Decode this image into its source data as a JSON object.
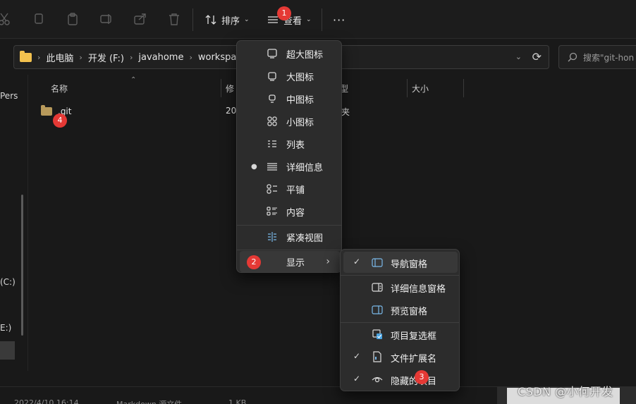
{
  "toolbar": {
    "sort_label": "排序",
    "view_label": "查看",
    "more_label": "···"
  },
  "address": {
    "crumbs": [
      "此电脑",
      "开发 (F:)",
      "javahome",
      "workspac"
    ]
  },
  "search": {
    "placeholder": "搜索\"git-hon"
  },
  "nav": {
    "item_pers": "Pers",
    "item_c": "(C:)",
    "item_e": "E:)"
  },
  "columns": {
    "name": "名称",
    "modified": "修",
    "type": "型",
    "size": "大小"
  },
  "files": [
    {
      "name": ".git",
      "modified": "20",
      "type": "夹"
    }
  ],
  "status": {
    "date": "2022/4/10 16:14",
    "type": "Markdown 源文件",
    "size": "1 KB"
  },
  "view_menu": {
    "items": [
      {
        "label": "超大图标",
        "icon": "monitor-icon"
      },
      {
        "label": "大图标",
        "icon": "monitor-icon"
      },
      {
        "label": "中图标",
        "icon": "monitor-small-icon"
      },
      {
        "label": "小图标",
        "icon": "grid-icon"
      },
      {
        "label": "列表",
        "icon": "list-icon"
      },
      {
        "label": "详细信息",
        "icon": "details-icon",
        "selected": true
      },
      {
        "label": "平铺",
        "icon": "tiles-icon"
      },
      {
        "label": "内容",
        "icon": "content-icon"
      },
      {
        "label": "紧凑视图",
        "icon": "compact-icon"
      },
      {
        "label": "显示",
        "icon": "",
        "submenu": true
      }
    ]
  },
  "show_submenu": {
    "items": [
      {
        "label": "导航窗格",
        "checked": true,
        "icon": "nav-pane-icon"
      },
      {
        "label": "详细信息窗格",
        "checked": false,
        "icon": "details-pane-icon"
      },
      {
        "label": "预览窗格",
        "checked": false,
        "icon": "preview-pane-icon"
      },
      {
        "label": "项目复选框",
        "checked": false,
        "icon": "checkbox-icon"
      },
      {
        "label": "文件扩展名",
        "checked": true,
        "icon": "file-ext-icon"
      },
      {
        "label": "隐藏的项目",
        "checked": true,
        "icon": "eye-icon"
      }
    ]
  },
  "badges": [
    "1",
    "2",
    "3",
    "4"
  ],
  "watermark": "CSDN @小何开发",
  "colors": {
    "badge": "#e53935",
    "accent": "#4aa3e0"
  }
}
